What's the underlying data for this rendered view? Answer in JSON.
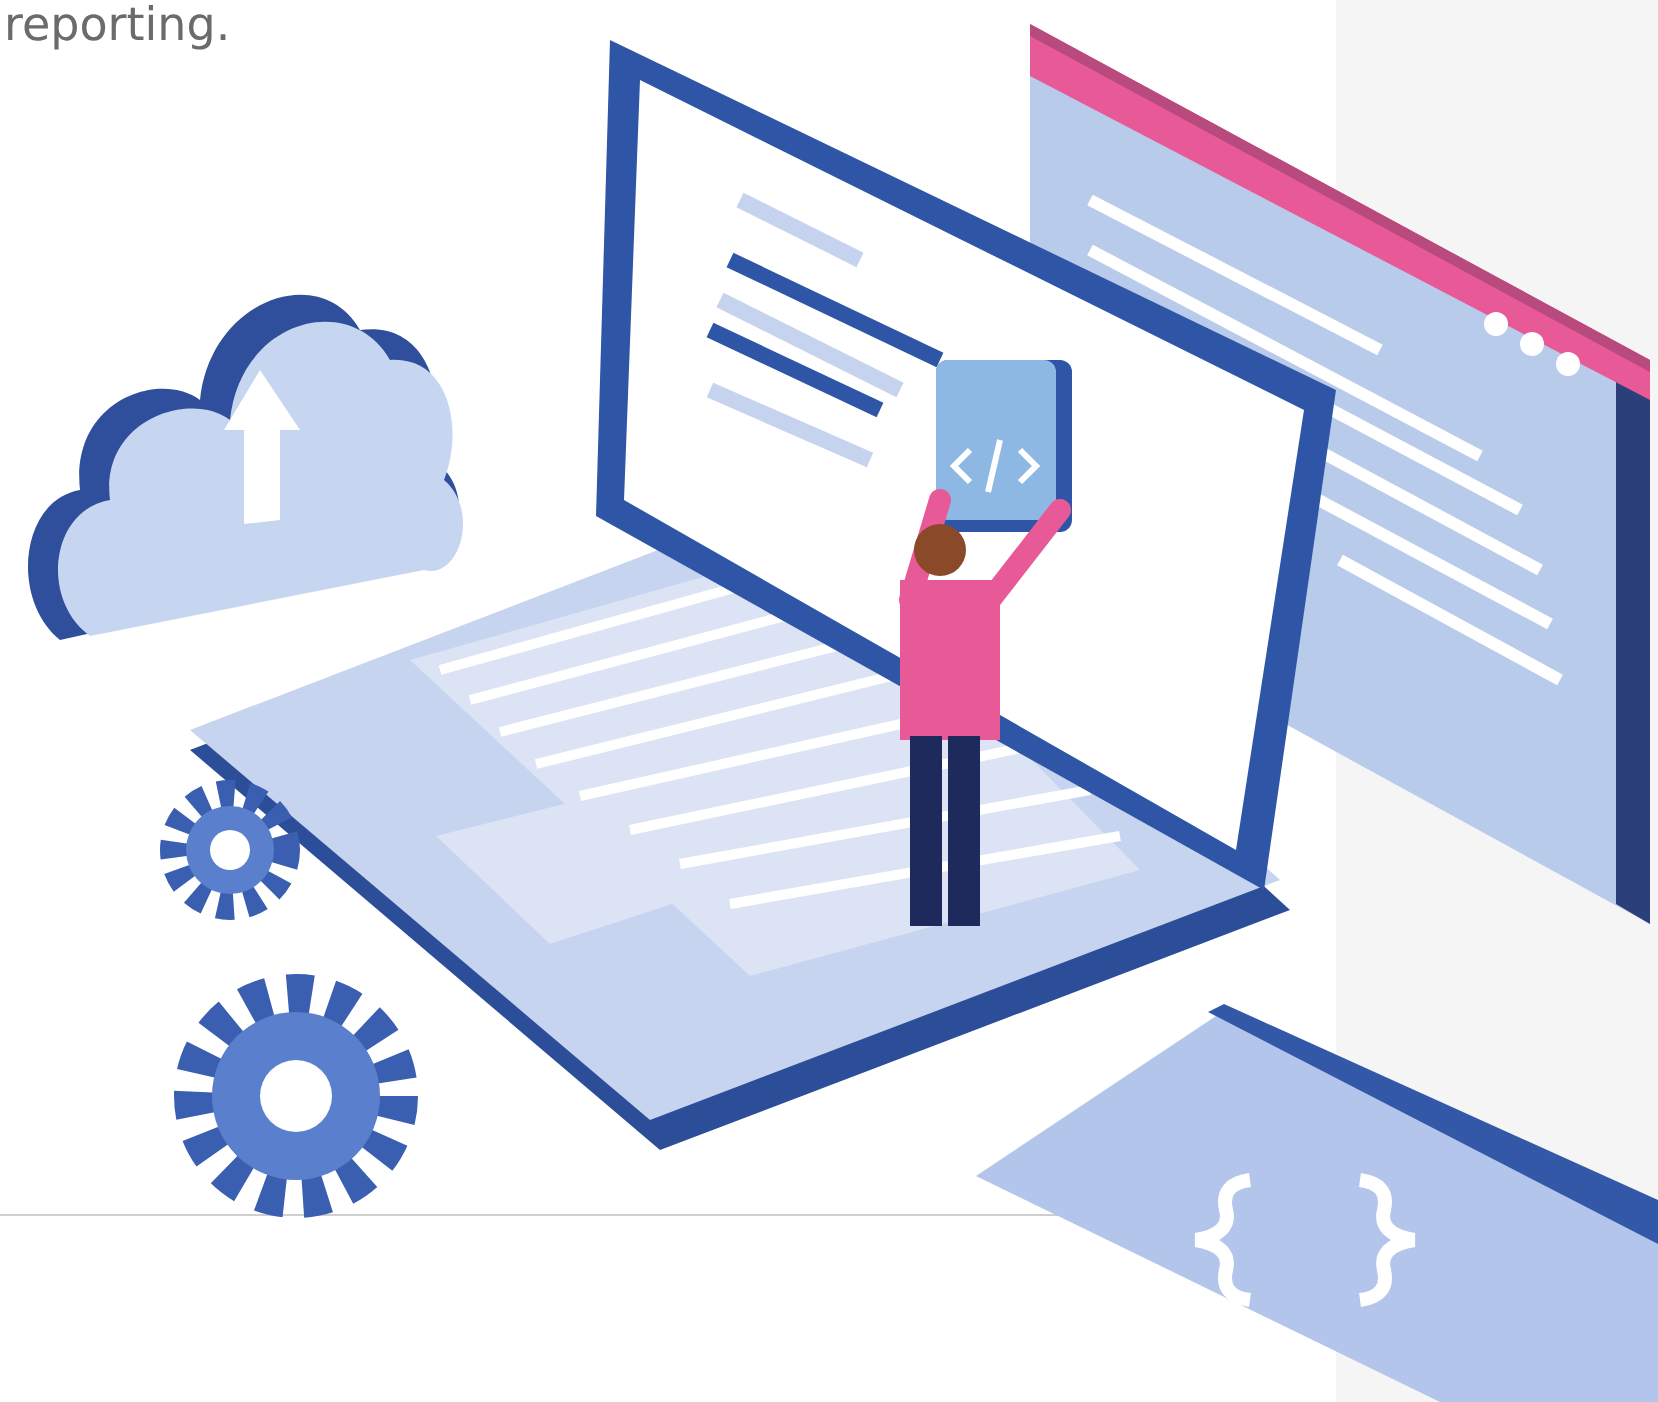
{
  "intro": {
    "text": "reporting."
  }
}
